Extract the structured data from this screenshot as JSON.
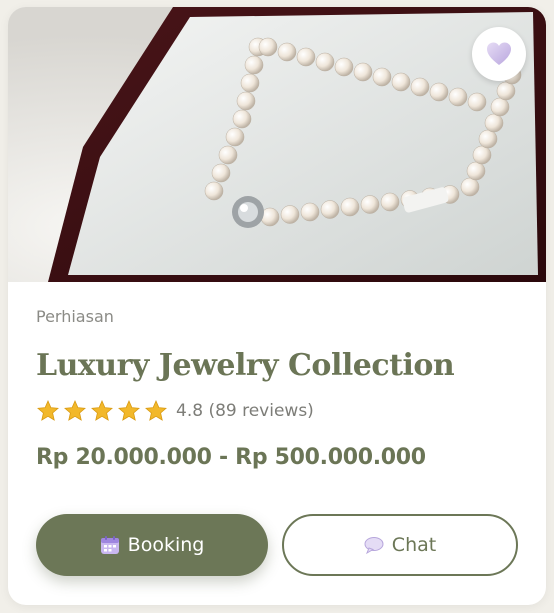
{
  "product": {
    "category": "Perhiasan",
    "title": "Luxury Jewelry Collection",
    "rating_text": "4.8 (89 reviews)",
    "rating": 4.8,
    "max_rating": 5,
    "price": "Rp 20.000.000 - Rp 500.000.000"
  },
  "actions": {
    "booking_label": "Booking",
    "chat_label": "Chat"
  },
  "icons": {
    "favorite": "heart-icon",
    "booking": "calendar-icon",
    "chat": "speech-bubble-icon",
    "star": "star-icon"
  },
  "colors": {
    "accent": "#6c7757",
    "star": "#f2b82a"
  }
}
